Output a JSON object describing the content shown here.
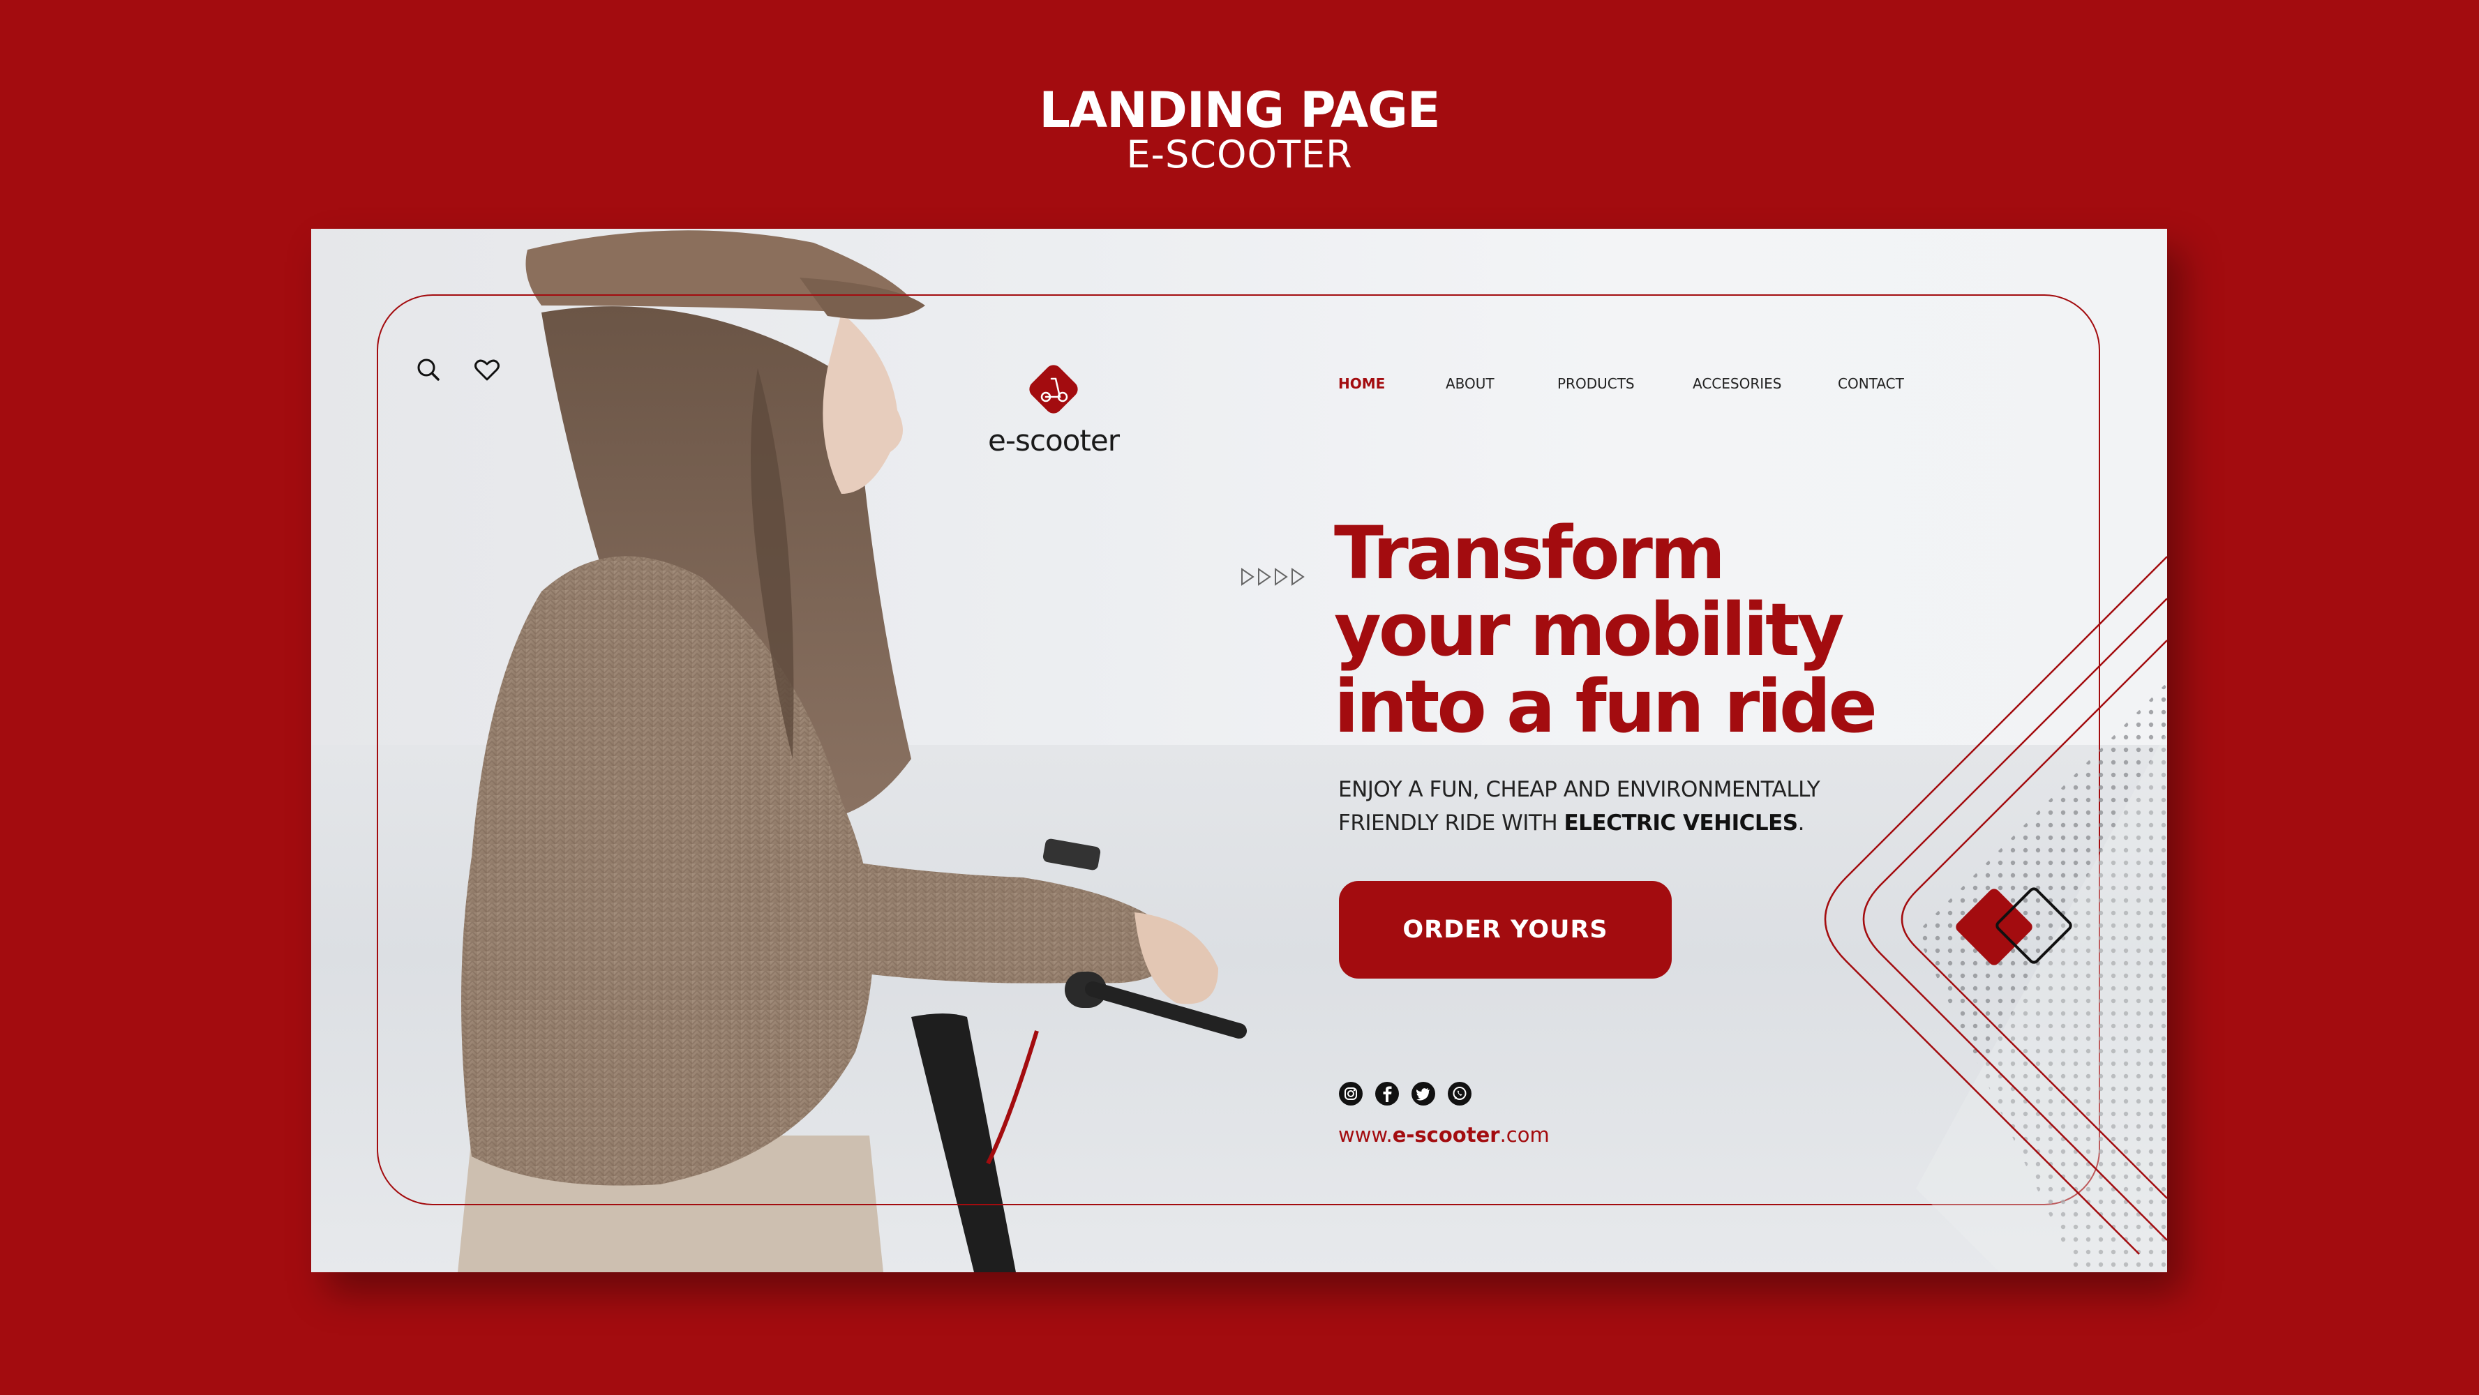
{
  "header": {
    "title": "LANDING PAGE",
    "subtitle": "E-SCOOTER"
  },
  "brand": {
    "name": "e-scooter",
    "logo_icon": "scooter-icon",
    "accent_color": "#a30c0f"
  },
  "toolbar": {
    "icons": [
      "search-icon",
      "heart-icon"
    ]
  },
  "nav": {
    "items": [
      {
        "label": "HOME",
        "active": true
      },
      {
        "label": "ABOUT",
        "active": false
      },
      {
        "label": "PRODUCTS",
        "active": false
      },
      {
        "label": "ACCESORIES",
        "active": false
      },
      {
        "label": "CONTACT",
        "active": false
      }
    ]
  },
  "hero": {
    "headline_lines": [
      "Transform",
      "your mobility",
      "into a fun ride"
    ],
    "subtext_line1": "ENJOY A FUN, CHEAP AND ENVIRONMENTALLY",
    "subtext_line2_prefix": "FRIENDLY RIDE WITH ",
    "subtext_line2_bold": "ELECTRIC VEHICLES",
    "subtext_line2_suffix": ".",
    "cta_label": "ORDER YOURS"
  },
  "social": {
    "icons": [
      "instagram-icon",
      "facebook-icon",
      "twitter-icon",
      "whatsapp-icon"
    ]
  },
  "footer": {
    "website_prefix": "www.",
    "website_bold": "e-scooter",
    "website_suffix": ".com"
  },
  "colors": {
    "background": "#a30c0f",
    "card": "#eef0f2",
    "text_dark": "#222222"
  }
}
